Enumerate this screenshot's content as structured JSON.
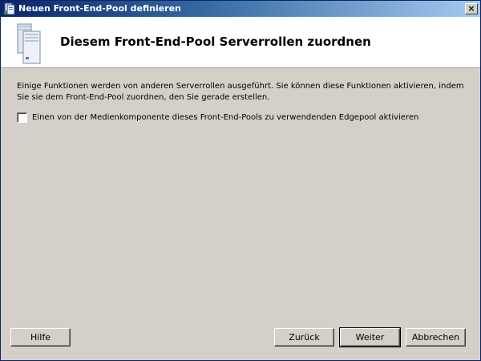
{
  "window": {
    "title": "Neuen Front-End-Pool definieren",
    "close_label": "×"
  },
  "header": {
    "title": "Diesem Front-End-Pool Serverrollen zuordnen"
  },
  "content": {
    "description": "Einige Funktionen werden von anderen Serverrollen ausgeführt. Sie können diese Funktionen aktivieren, indem Sie sie dem Front-End-Pool zuordnen, den Sie gerade erstellen.",
    "option": {
      "label": "Einen von der Medienkomponente dieses Front-End-Pools zu verwendenden Edgepool aktivieren",
      "checked": false
    }
  },
  "buttons": {
    "help": "Hilfe",
    "back": "Zurück",
    "next": "Weiter",
    "cancel": "Abbrechen"
  },
  "colors": {
    "title_bar_start": "#0a246a",
    "title_bar_end": "#a6caf0",
    "dialog_bg": "#d4d0c8",
    "header_bg": "#ffffff"
  },
  "icons": {
    "title": "server-icon",
    "header": "server-stack-icon",
    "close": "close-icon"
  }
}
